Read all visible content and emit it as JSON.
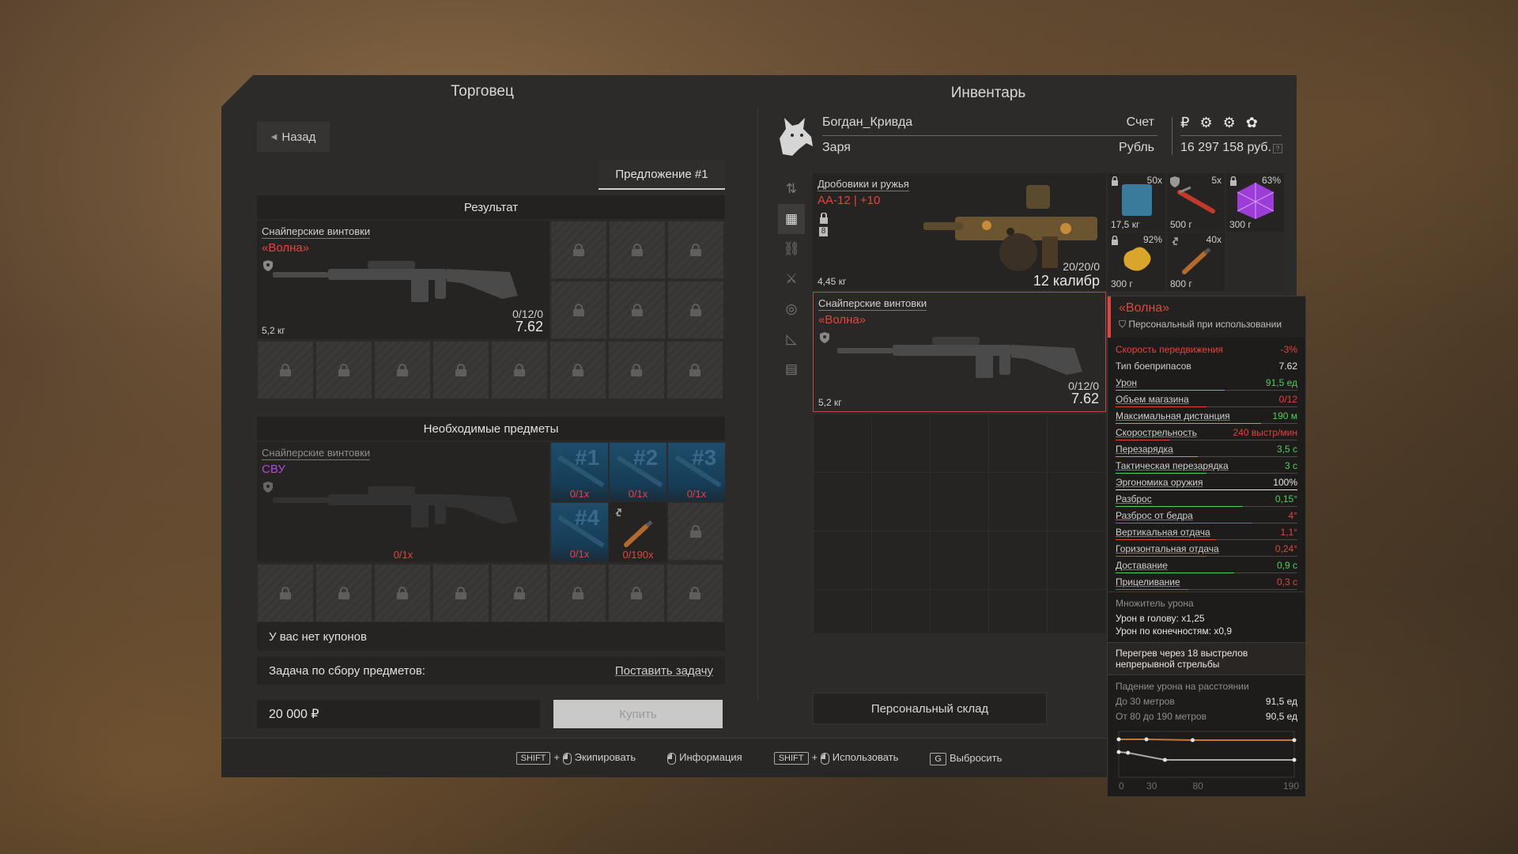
{
  "merchant": {
    "title": "Торговец",
    "back_label": "Назад",
    "offer_tab": "Предложение #1",
    "result_header": "Результат",
    "result_item": {
      "category": "Снайперские винтовки",
      "name": "«Волна»",
      "weight": "5,2 кг",
      "ammo": "0/12/0",
      "caliber": "7.62"
    },
    "required_header": "Необходимые предметы",
    "required_item": {
      "category": "Снайперские винтовки",
      "name": "СВУ",
      "qty": "0/1x"
    },
    "required_slots": [
      {
        "num": "#1",
        "qty": "0/1x"
      },
      {
        "num": "#2",
        "qty": "0/1x"
      },
      {
        "num": "#3",
        "qty": "0/1x"
      },
      {
        "num": "#4",
        "qty": "0/1x"
      }
    ],
    "required_extra": {
      "qty": "0/190x"
    },
    "coupons": "У вас нет купонов",
    "task_label": "Задача по сбору предметов:",
    "task_link": "Поставить задачу",
    "price": "20 000 ₽",
    "buy_label": "Купить"
  },
  "inventory": {
    "title": "Инвентарь",
    "player_name": "Богдан_Кривда",
    "faction": "Заря",
    "account_label": "Счет",
    "currency_label": "Рубль",
    "currency_symbols": "₽ ⚙ ⚙ ✿",
    "balance": "16 297 158 руб.",
    "main_item": {
      "category": "Дробовики и ружья",
      "name": "АА-12 | +10",
      "weight": "4,45 кг",
      "ammo": "20/20/0",
      "caliber": "12 калибр",
      "level": "8"
    },
    "small_items": [
      {
        "count": "50x",
        "weight": "17,5 кг",
        "color": "#3a7a9a"
      },
      {
        "count": "5x",
        "weight": "500 г",
        "color": "#c0392b"
      },
      {
        "count": "63%",
        "weight": "300 г",
        "color": "#9b3dd6"
      },
      {
        "count": "92%",
        "weight": "300 г",
        "color": "#d9a52b"
      },
      {
        "count": "40x",
        "weight": "800 г",
        "color": "#b36a2e"
      }
    ],
    "volna_item": {
      "category": "Снайперские винтовки",
      "name": "«Волна»",
      "weight": "5,2 кг",
      "ammo": "0/12/0",
      "caliber": "7.62"
    },
    "stash_label": "Персональный склад"
  },
  "tooltip": {
    "title": "«Волна»",
    "subtitle": "Персональный при использовании",
    "stats": [
      {
        "label": "Скорость передвижения",
        "value": "-3%",
        "color": "red",
        "fill": 0,
        "plain": true
      },
      {
        "label": "Тип боеприпасов",
        "value": "7.62",
        "color": "white",
        "fill": 0,
        "plain": true
      },
      {
        "label": "Урон",
        "value": "91,5 ед",
        "color": "green",
        "fill": 0.6
      },
      {
        "label": "Объем магазина",
        "value": "0/12",
        "color": "red",
        "fill": 0.5
      },
      {
        "label": "Максимальная дистанция",
        "value": "190 м",
        "color": "green",
        "fill": 0.8
      },
      {
        "label": "Скорострельность",
        "value": "240 выстр/мин",
        "color": "red",
        "fill": 0.3
      },
      {
        "label": "Перезарядка",
        "value": "3,5 с",
        "color": "green",
        "fill": 0.45
      },
      {
        "label": "Тактическая перезарядка",
        "value": "3 с",
        "color": "green",
        "fill": 0.5
      },
      {
        "label": "Эргономика оружия",
        "value": "100%",
        "color": "white",
        "fill": 1.0
      },
      {
        "label": "Разброс",
        "value": "0,15°",
        "color": "green",
        "fill": 0.7
      },
      {
        "label": "Разброс от бедра",
        "value": "4°",
        "color": "red",
        "fill": 0.75
      },
      {
        "label": "Вертикальная отдача",
        "value": "1,1°",
        "color": "red",
        "fill": 0.55
      },
      {
        "label": "Горизонтальная отдача",
        "value": "0,24°",
        "color": "red",
        "fill": 0.5
      },
      {
        "label": "Доставание",
        "value": "0,9 с",
        "color": "green",
        "fill": 0.65
      },
      {
        "label": "Прицеливание",
        "value": "0,3 с",
        "color": "red",
        "fill": 0.4
      }
    ],
    "damage_mult_title": "Множитель урона",
    "head_mult": "Урон в голову: x1,25",
    "limb_mult": "Урон по конечностям: x0,9",
    "overheat": "Перегрев через 18 выстрелов непрерывной стрельбы",
    "falloff_title": "Падение урона на расстоянии",
    "falloff": [
      {
        "label": "До 30 метров",
        "value": "91,5 ед"
      },
      {
        "label": "От 80 до 190 метров",
        "value": "90,5 ед"
      }
    ],
    "chart_ticks": [
      "0",
      "30",
      "80",
      "190"
    ]
  },
  "footer": {
    "equip_key": "SHIFT",
    "equip": "Экипировать",
    "info": "Информация",
    "use_key": "SHIFT",
    "use": "Использовать",
    "drop_key": "G",
    "drop": "Выбросить"
  },
  "colors": {
    "accent_red": "#e0453f",
    "green": "#4fcf5b",
    "purple": "#b04bd6"
  }
}
